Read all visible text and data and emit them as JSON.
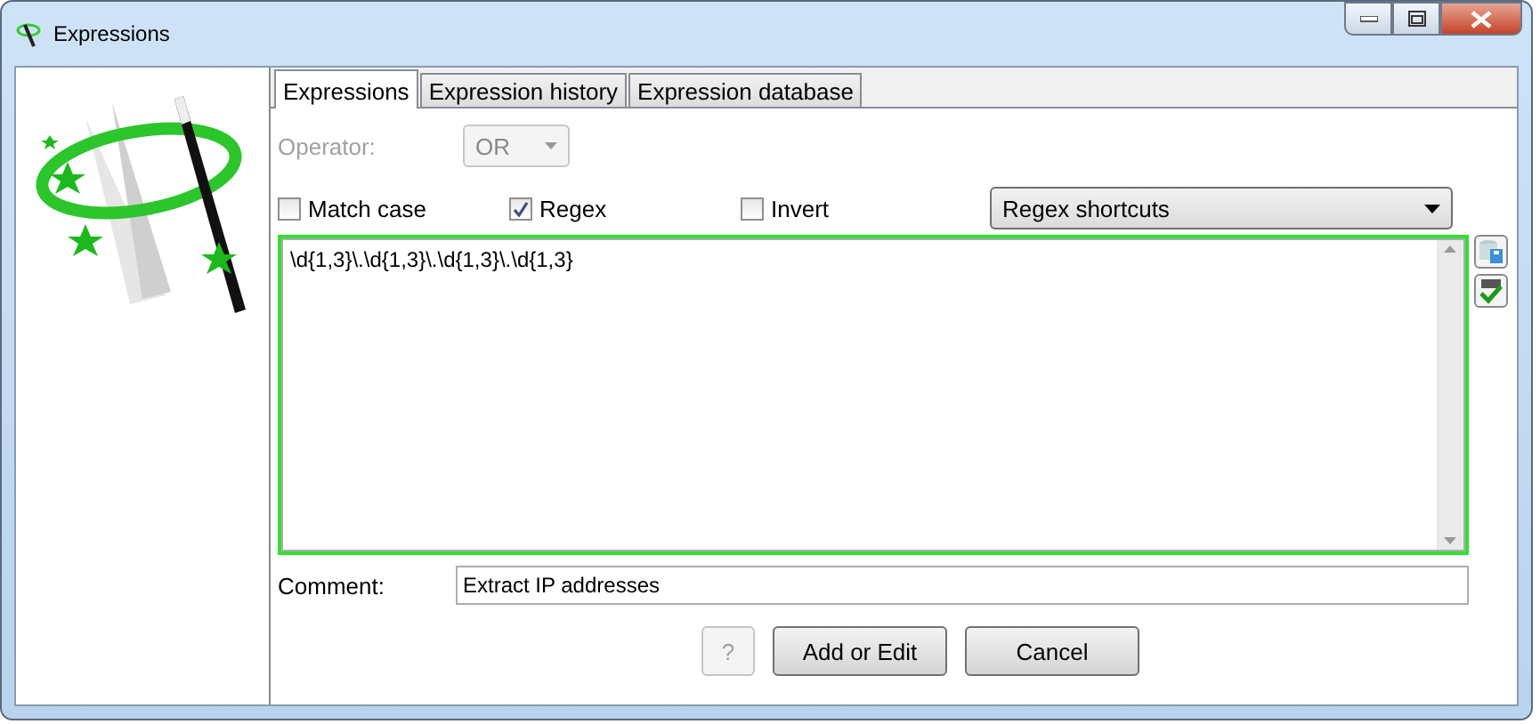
{
  "window": {
    "title": "Expressions"
  },
  "tabs": [
    {
      "label": "Expressions",
      "selected": true
    },
    {
      "label": "Expression history",
      "selected": false
    },
    {
      "label": "Expression database",
      "selected": false
    }
  ],
  "operator": {
    "label": "Operator:",
    "value": "OR",
    "disabled": true
  },
  "options": [
    {
      "label": "Match case",
      "checked": false
    },
    {
      "label": "Regex",
      "checked": true
    },
    {
      "label": "Invert",
      "checked": false
    }
  ],
  "shortcuts": {
    "value": "Regex shortcuts"
  },
  "expression": {
    "value": "\\d{1,3}\\.\\d{1,3}\\.\\d{1,3}\\.\\d{1,3}"
  },
  "comment": {
    "label": "Comment:",
    "value": "Extract IP addresses"
  },
  "buttons": [
    {
      "label": "?",
      "disabled": true
    },
    {
      "label": "Add or Edit",
      "disabled": false
    },
    {
      "label": "Cancel",
      "disabled": false
    }
  ]
}
